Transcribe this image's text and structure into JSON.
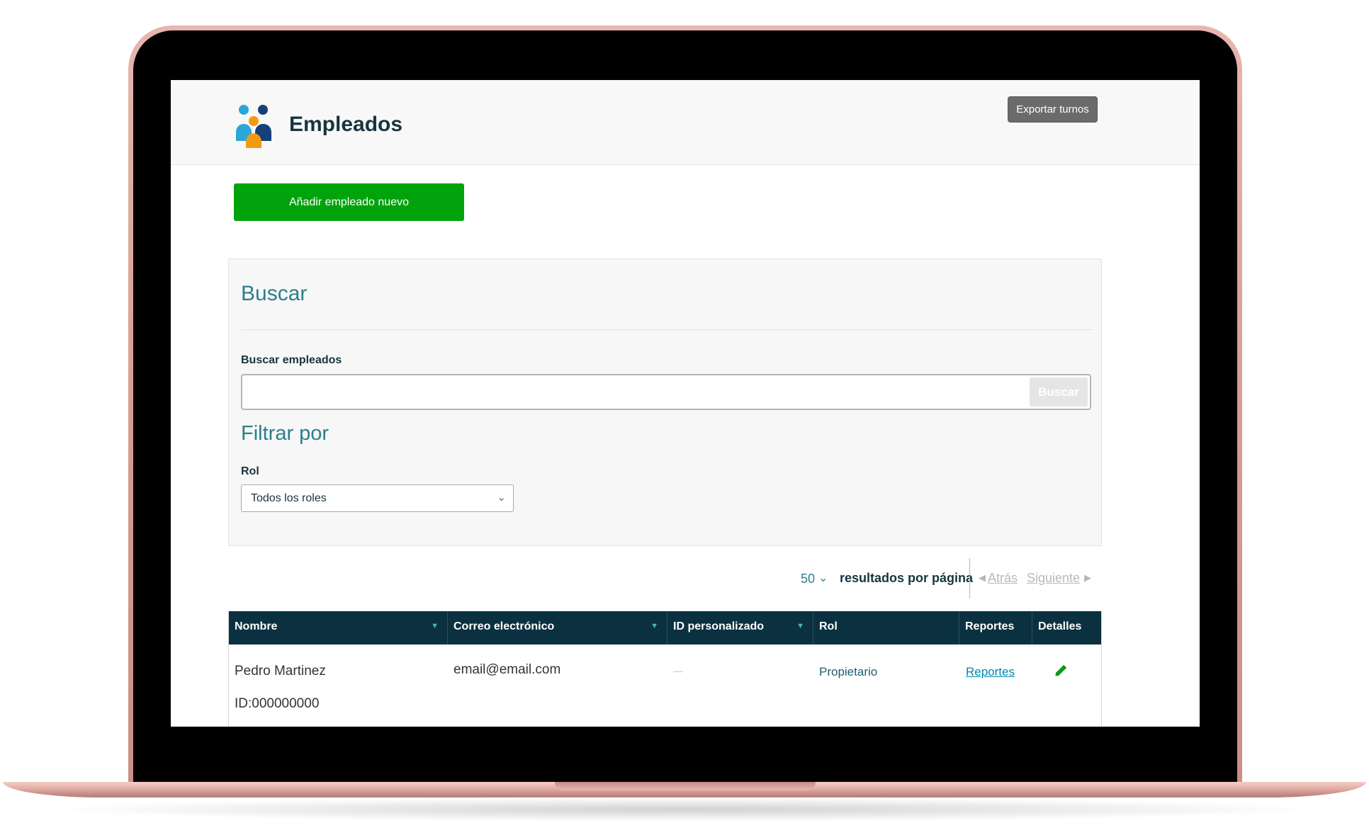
{
  "header": {
    "title": "Empleados",
    "export_label": "Exportar turnos"
  },
  "actions": {
    "add_employee_label": "Añadir empleado nuevo"
  },
  "search": {
    "title": "Buscar",
    "field_label": "Buscar empleados",
    "value": "",
    "placeholder": "",
    "button_label": "Buscar"
  },
  "filter": {
    "title": "Filtrar por",
    "role_label": "Rol",
    "role_selected": "Todos los roles"
  },
  "pagination": {
    "per_page_value": "50",
    "per_page_label": "resultados por página",
    "prev_label": "Atrás",
    "next_label": "Siguiente"
  },
  "table": {
    "columns": [
      "Nombre",
      "Correo electrónico",
      "ID personalizado",
      "Rol",
      "Reportes",
      "Detalles"
    ],
    "rows": [
      {
        "name": "Pedro Martinez",
        "id_line": "ID:000000000",
        "email": "email@email.com",
        "custom_id": "—",
        "role": "Propietario",
        "reports": "Reportes"
      }
    ]
  },
  "icons": {
    "logo": "people-group-icon",
    "sort": "sort-down-icon",
    "select_chevron": "chevron-down-icon",
    "edit": "pencil-icon",
    "prev": "chevron-left-icon",
    "next": "chevron-right-icon"
  },
  "colors": {
    "primary_green": "#00a30b",
    "teal_heading": "#2b7f8c",
    "table_header_bg": "#0b3141",
    "link_blue": "#0086b3",
    "export_button_bg": "#6b6b6b"
  }
}
